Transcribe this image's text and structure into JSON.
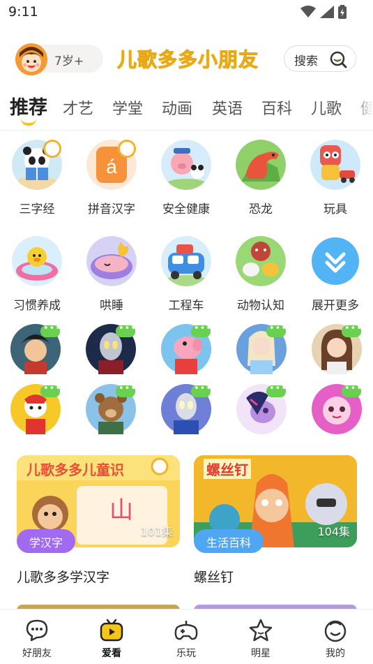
{
  "status_bar": {
    "time": "9:11",
    "icons": [
      "wifi-icon",
      "signal-icon",
      "battery-charging-icon"
    ]
  },
  "header": {
    "age_label": "7岁+",
    "brand_title": "儿歌多多小朋友",
    "search_label": "搜索",
    "accent_color": "#f6c41a"
  },
  "tabs": [
    "推荐",
    "才艺",
    "学堂",
    "动画",
    "英语",
    "百科",
    "儿歌",
    "健"
  ],
  "active_tab": "推荐",
  "categories": [
    {
      "label": "三字经",
      "icon": "panda-reading-icon"
    },
    {
      "label": "拼音汉字",
      "icon": "pinyin-a-icon"
    },
    {
      "label": "安全健康",
      "icon": "pig-police-icon"
    },
    {
      "label": "恐龙",
      "icon": "dinosaur-icon"
    },
    {
      "label": "玩具",
      "icon": "toy-robot-icon"
    },
    {
      "label": "习惯养成",
      "icon": "duck-bath-icon"
    },
    {
      "label": "哄睡",
      "icon": "sleeping-baby-icon"
    },
    {
      "label": "工程车",
      "icon": "truck-icon"
    },
    {
      "label": "动物认知",
      "icon": "animals-icon"
    },
    {
      "label": "展开更多",
      "icon": "expand-more-icon"
    }
  ],
  "characters": [
    "boy-hero-avatar",
    "ultraman-dark-avatar",
    "peppa-pig-avatar",
    "elsa-avatar",
    "girl-avatar",
    "paw-patrol-avatar",
    "bear-avatar",
    "ultraman-blue-avatar",
    "pony-avatar",
    "pink-pet-avatar"
  ],
  "cards": [
    {
      "banner_text": "儿歌多多儿童识",
      "episodes": "101集",
      "tag": "学汉字",
      "title": "儿歌多多学汉字",
      "tag_color": "#a06bf0"
    },
    {
      "banner_text": "螺丝钉",
      "episodes": "104集",
      "tag": "生活百科",
      "title": "螺丝钉",
      "tag_color": "#4fa6f2"
    }
  ],
  "bottom_nav": [
    {
      "label": "好朋友",
      "icon": "chat-bubble-icon"
    },
    {
      "label": "爱看",
      "icon": "tv-icon"
    },
    {
      "label": "乐玩",
      "icon": "gamepad-icon"
    },
    {
      "label": "明星",
      "icon": "star-icon"
    },
    {
      "label": "我的",
      "icon": "face-icon"
    }
  ],
  "active_nav": "爱看"
}
